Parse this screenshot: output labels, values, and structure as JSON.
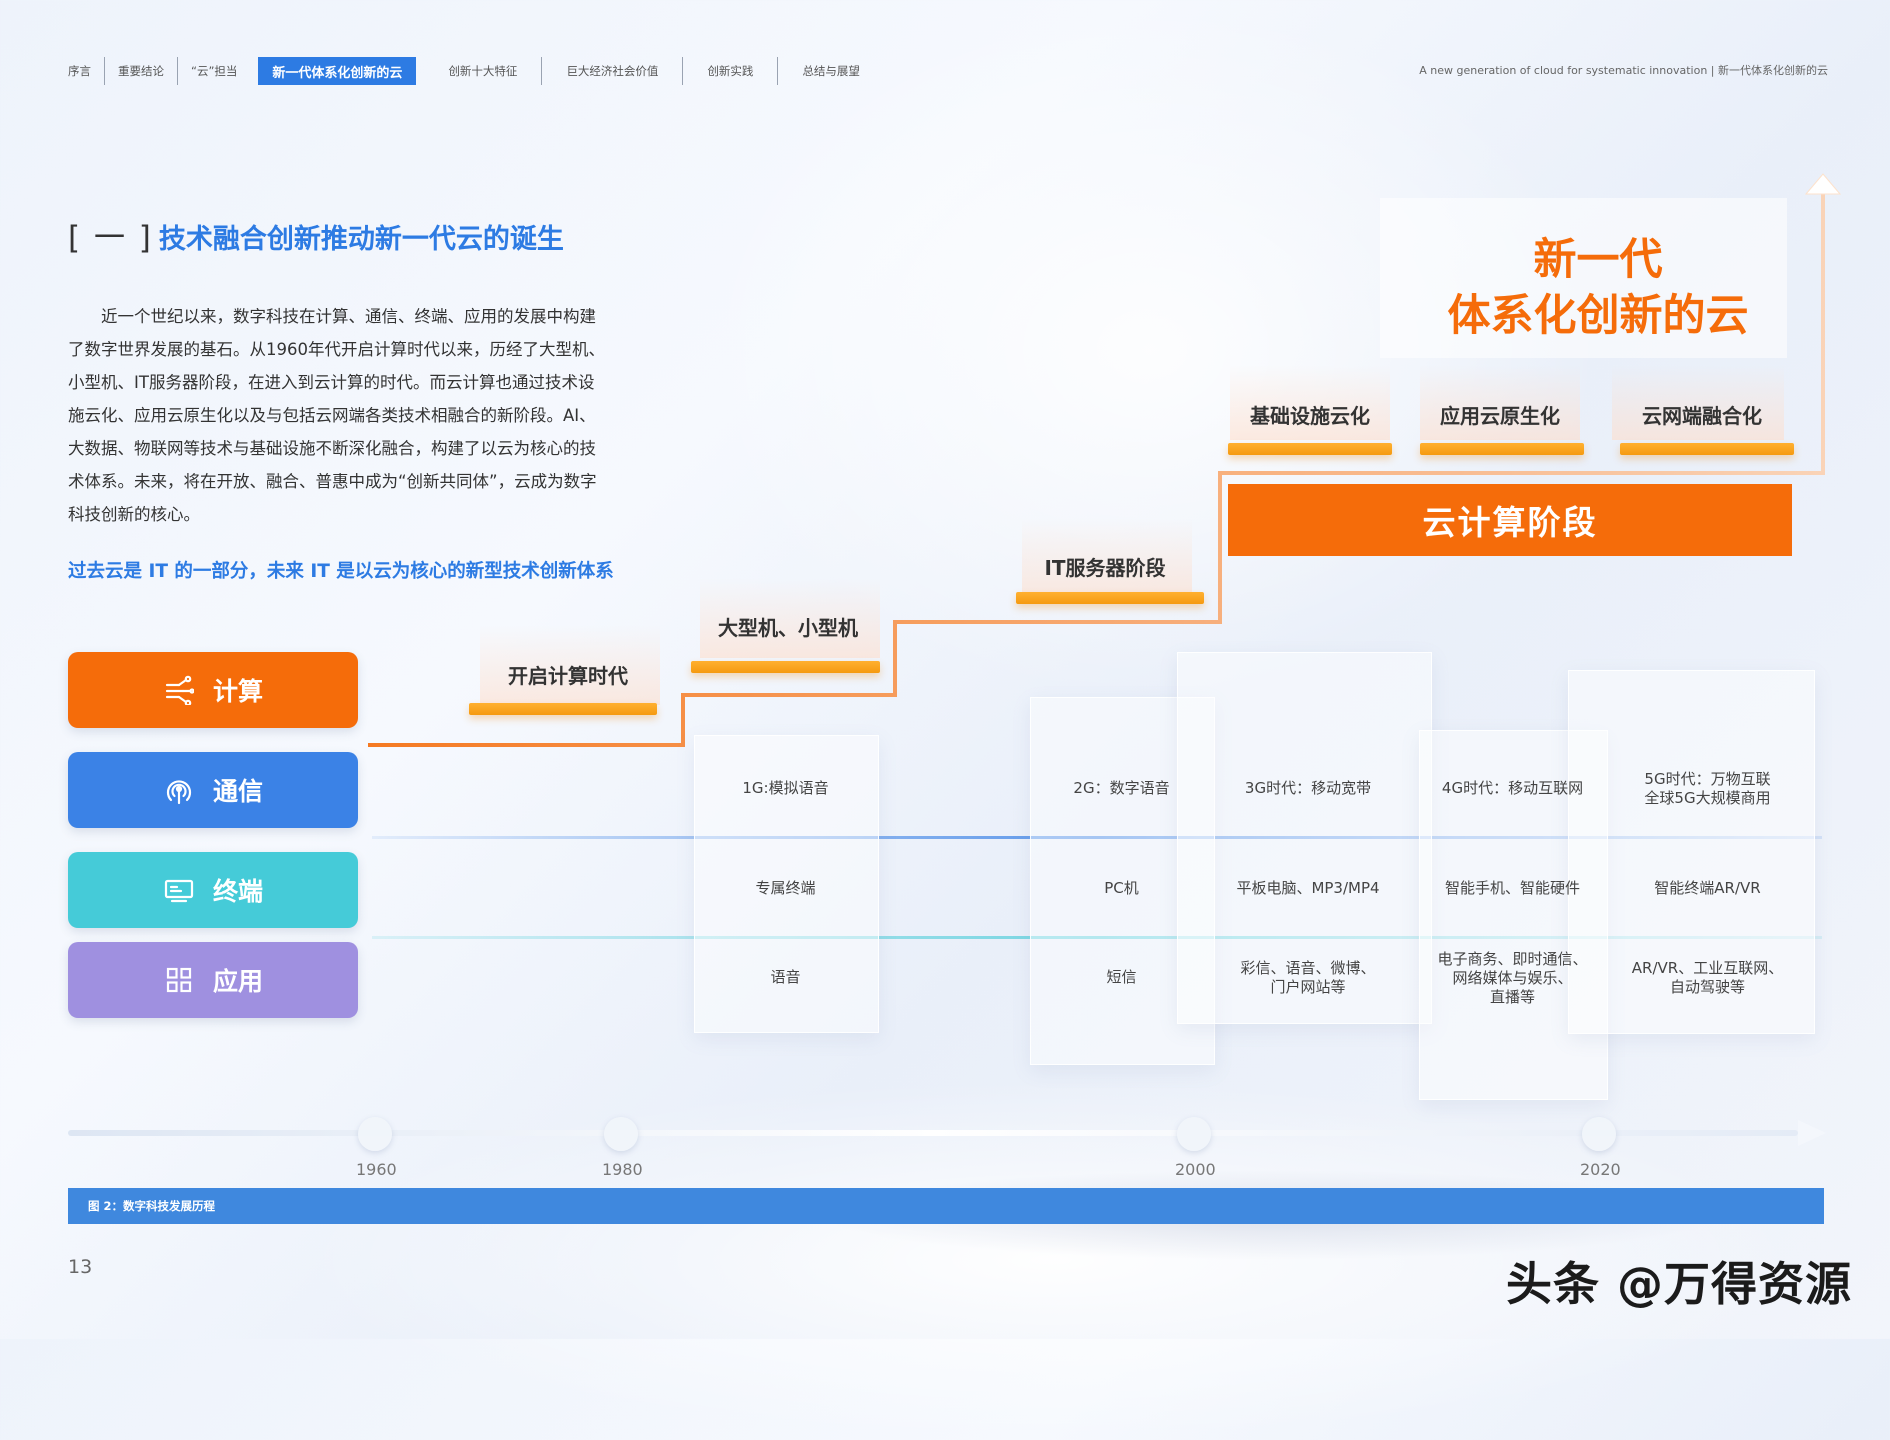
{
  "nav": {
    "tabs": [
      {
        "label": "序言"
      },
      {
        "label": "重要结论"
      },
      {
        "label": "“云”担当"
      },
      {
        "label": "新一代体系化创新的云"
      },
      {
        "label": "创新十大特征"
      },
      {
        "label": "巨大经济社会价值"
      },
      {
        "label": "创新实践"
      },
      {
        "label": "总结与展望"
      }
    ],
    "active_index": 3,
    "right_text": "A new generation of cloud for systematic innovation  |  新一代体系化创新的云"
  },
  "section": {
    "bracket": "[ 一 ]",
    "title": "技术融合创新推动新一代云的诞生",
    "body": "近一个世纪以来，数字科技在计算、通信、终端、应用的发展中构建了数字世界发展的基石。从1960年代开启计算时代以来，历经了大型机、小型机、IT服务器阶段，在进入到云计算的时代。而云计算也通过技术设施云化、应用云原生化以及与包括云网端各类技术相融合的新阶段。AI、大数据、物联网等技术与基础设施不断深化融合，构建了以云为核心的技术体系。未来，将在开放、融合、普惠中成为“创新共同体”，云成为数字科技创新的核心。",
    "highlight": "过去云是 IT 的一部分，未来 IT 是以云为核心的新型技术创新体系"
  },
  "categories": [
    {
      "label": "计算",
      "icon": "compute-icon",
      "color": "#f56c0a"
    },
    {
      "label": "通信",
      "icon": "signal-icon",
      "color": "#3b82e6"
    },
    {
      "label": "终端",
      "icon": "monitor-icon",
      "color": "#45cbd8"
    },
    {
      "label": "应用",
      "icon": "grid-icon",
      "color": "#9f90e0"
    }
  ],
  "stages": {
    "s1": "开启计算时代",
    "s2": "大型机、小型机",
    "s3": "IT服务器阶段",
    "cloud": "云计算阶段",
    "sub": [
      "基础设施云化",
      "应用云原生化",
      "云网端融合化"
    ],
    "new_gen_line1": "新一代",
    "new_gen_line2": "体系化创新的云"
  },
  "columns": [
    {
      "comm": "1G:模拟语音",
      "term": "专属终端",
      "app": "语音"
    },
    {
      "comm": "2G：数字语音",
      "term": "PC机",
      "app": "短信"
    },
    {
      "comm": "3G时代：移动宽带",
      "term": "平板电脑、MP3/MP4",
      "app": "彩信、语音、微博、\n门户网站等"
    },
    {
      "comm": "4G时代：移动互联网",
      "term": "智能手机、智能硬件",
      "app": "电子商务、即时通信、\n网络媒体与娱乐、\n直播等"
    },
    {
      "comm": "5G时代：万物互联\n全球5G大规模商用",
      "term": "智能终端AR/VR",
      "app": "AR/VR、工业互联网、\n自动驾驶等"
    }
  ],
  "timeline": {
    "years": [
      "1960",
      "1980",
      "2000",
      "2020"
    ]
  },
  "caption": "图 2：数字科技发展历程",
  "page_number": "13",
  "watermark": "头条 @万得资源"
}
